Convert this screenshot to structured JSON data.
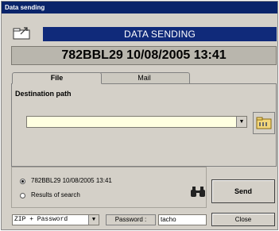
{
  "window": {
    "title": "Data sending"
  },
  "header": {
    "title": "DATA SENDING",
    "icon": "folder-send-icon"
  },
  "info": {
    "text": "782BBL29   10/08/2005 13:41"
  },
  "tabs": [
    {
      "label": "File",
      "active": true
    },
    {
      "label": "Mail",
      "active": false
    }
  ],
  "destination": {
    "label": "Destination path",
    "value": "",
    "browse_icon": "folder-browse-icon"
  },
  "source": {
    "options": [
      {
        "label": "782BBL29  10/08/2005 13:41",
        "checked": true
      },
      {
        "label": "Results of search",
        "checked": false
      }
    ],
    "search_icon": "binoculars-icon"
  },
  "buttons": {
    "send": "Send",
    "close": "Close"
  },
  "mode": {
    "value": "ZIP + Password"
  },
  "password": {
    "label": "Password :",
    "value": "tacho"
  }
}
